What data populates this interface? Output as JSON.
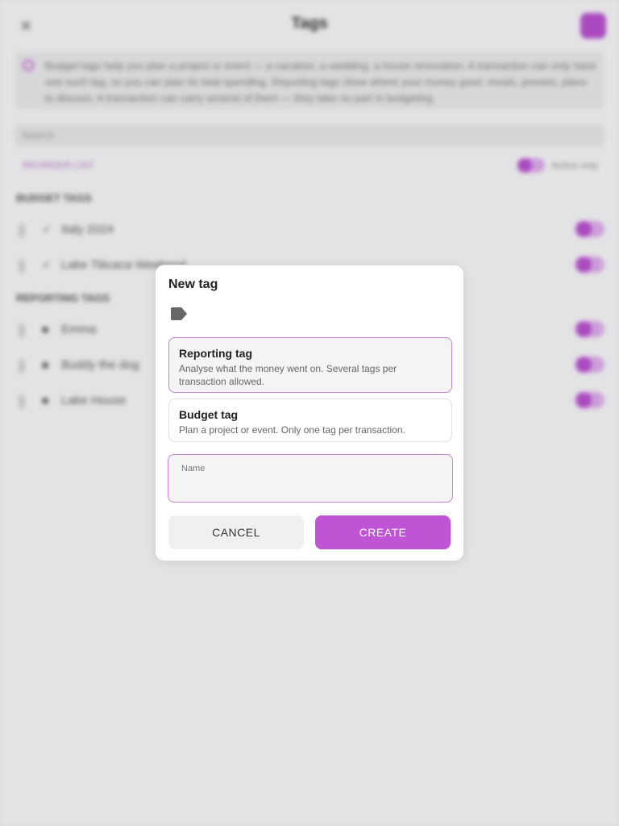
{
  "background": {
    "title": "Tags",
    "close_glyph": "✕",
    "info_text": "Budget tags help you plan a project or event — a vacation, a wedding, a house renovation. A transaction can only have one such tag, so you can plan its total spending. Reporting tags show where your money goes: meals, presets, plans to discuss. A transaction can carry several of them — they take no part in budgeting.",
    "search_placeholder": "Search",
    "filter_left": "REORDER LIST",
    "filter_right": "Active only",
    "budget_section": "BUDGET TAGS",
    "budget_rows": [
      {
        "icon": "✓",
        "label": "Italy 2024"
      },
      {
        "icon": "✓",
        "label": "Lake Titicaca Weekend"
      }
    ],
    "reporting_section": "REPORTING TAGS",
    "reporting_rows": [
      {
        "icon": "■",
        "label": "Emma"
      },
      {
        "icon": "■",
        "label": "Buddy the dog"
      },
      {
        "icon": "■",
        "label": "Lake House"
      }
    ]
  },
  "dialog": {
    "title": "New tag",
    "icon": "tag-icon",
    "options": [
      {
        "title": "Reporting tag",
        "description": "Analyse what the money went on. Several tags per transaction allowed.",
        "selected": true
      },
      {
        "title": "Budget tag",
        "description": "Plan a project or event. Only one tag per transaction.",
        "selected": false
      }
    ],
    "name_field": {
      "label": "Name",
      "value": ""
    },
    "cancel_label": "CANCEL",
    "create_label": "CREATE"
  },
  "colors": {
    "accent": "#bf55d4",
    "accent_border": "#c783d6",
    "surface": "#ffffff",
    "scrim_bg": "#e8e8ea"
  }
}
